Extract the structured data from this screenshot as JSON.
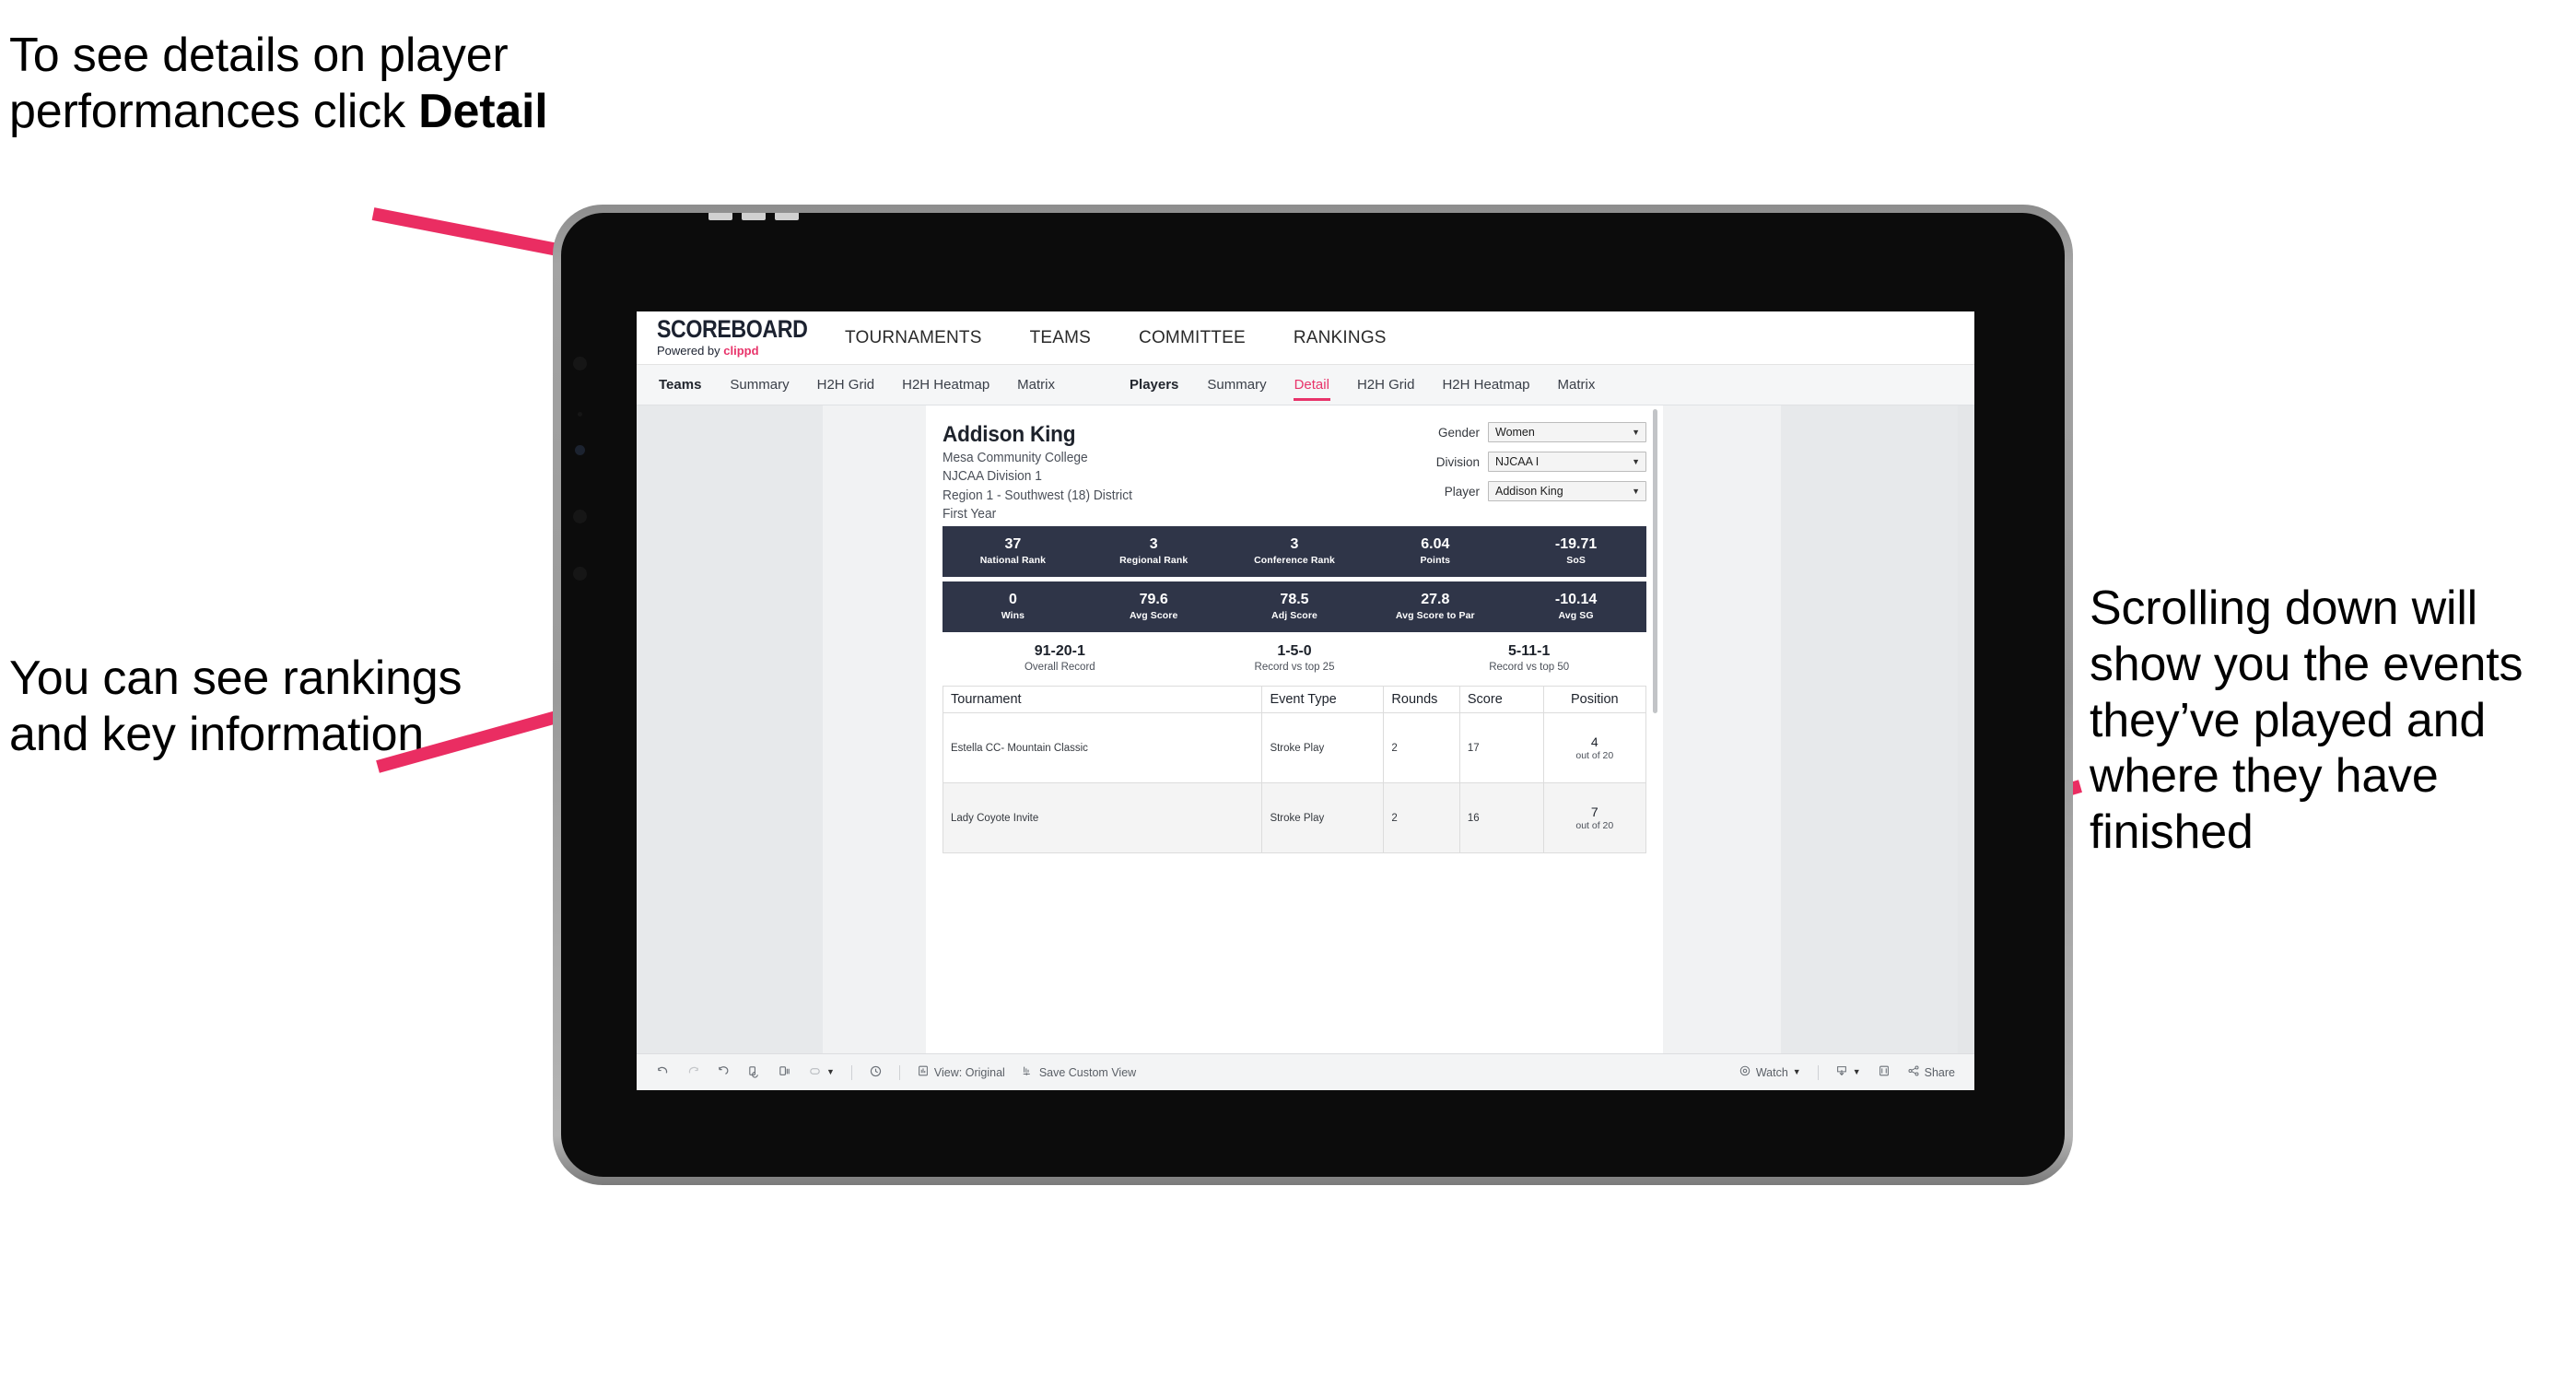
{
  "annotations": {
    "top_left": "To see details on player performances click ",
    "top_left_bold": "Detail",
    "mid_left": "You can see rankings and key information",
    "right": "Scrolling down will show you the events they’ve played and where they have finished",
    "arrow_color": "#ea2d62"
  },
  "app": {
    "logo": {
      "wordmark": "SCOREBOARD",
      "powered_prefix": "Powered by ",
      "brand": "clippd"
    },
    "top_nav": [
      "TOURNAMENTS",
      "TEAMS",
      "COMMITTEE",
      "RANKINGS"
    ],
    "tab_groups": [
      {
        "label": "Teams",
        "tabs": [
          "Summary",
          "H2H Grid",
          "H2H Heatmap",
          "Matrix"
        ],
        "active": null
      },
      {
        "label": "Players",
        "tabs": [
          "Summary",
          "Detail",
          "H2H Grid",
          "H2H Heatmap",
          "Matrix"
        ],
        "active": "Detail"
      }
    ],
    "accent": "#e8336a"
  },
  "player": {
    "name": "Addison King",
    "meta": [
      "Mesa Community College",
      "NJCAA Division 1",
      "Region 1 - Southwest (18) District",
      "First Year"
    ]
  },
  "filters": [
    {
      "label": "Gender",
      "value": "Women"
    },
    {
      "label": "Division",
      "value": "NJCAA I"
    },
    {
      "label": "Player",
      "value": "Addison King"
    }
  ],
  "stats_row_1": [
    {
      "value": "37",
      "label": "National Rank"
    },
    {
      "value": "3",
      "label": "Regional Rank"
    },
    {
      "value": "3",
      "label": "Conference Rank"
    },
    {
      "value": "6.04",
      "label": "Points"
    },
    {
      "value": "-19.71",
      "label": "SoS"
    }
  ],
  "stats_row_2": [
    {
      "value": "0",
      "label": "Wins"
    },
    {
      "value": "79.6",
      "label": "Avg Score"
    },
    {
      "value": "78.5",
      "label": "Adj Score"
    },
    {
      "value": "27.8",
      "label": "Avg Score to Par"
    },
    {
      "value": "-10.14",
      "label": "Avg SG"
    }
  ],
  "records": [
    {
      "value": "91-20-1",
      "label": "Overall Record"
    },
    {
      "value": "1-5-0",
      "label": "Record vs top 25"
    },
    {
      "value": "5-11-1",
      "label": "Record vs top 50"
    }
  ],
  "table": {
    "headers": [
      "Tournament",
      "Event Type",
      "Rounds",
      "Score",
      "Position"
    ],
    "rows": [
      {
        "tournament": "Estella CC- Mountain Classic",
        "event_type": "Stroke Play",
        "rounds": "2",
        "score": "17",
        "position_value": "4",
        "position_sub": "out of 20"
      },
      {
        "tournament": "Lady Coyote Invite",
        "event_type": "Stroke Play",
        "rounds": "2",
        "score": "16",
        "position_value": "7",
        "position_sub": "out of 20"
      }
    ]
  },
  "toolbar": {
    "view_label": "View: Original",
    "save_label": "Save Custom View",
    "watch_label": "Watch",
    "share_label": "Share"
  },
  "theme": {
    "stat_bar_bg": "#2f3548",
    "screen_bg": "#e7e9eb",
    "sheet_bg": "#ffffff"
  }
}
